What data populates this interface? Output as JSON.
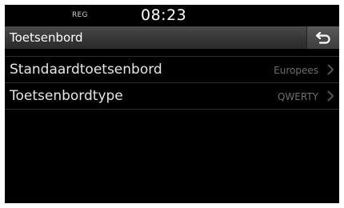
{
  "status": {
    "reg": "REG",
    "time": "08:23"
  },
  "header": {
    "title": "Toetsenbord",
    "back_icon": "back-arrow-icon"
  },
  "settings": [
    {
      "label": "Standaardtoetsenbord",
      "value": "Europees",
      "icon": "chevron-right-icon"
    },
    {
      "label": "Toetsenbordtype",
      "value": "QWERTY",
      "icon": "chevron-right-icon"
    }
  ],
  "colors": {
    "background": "#000000",
    "header": "#3a3a3a",
    "text": "#e6e6e6",
    "value": "#6f6f6f"
  }
}
